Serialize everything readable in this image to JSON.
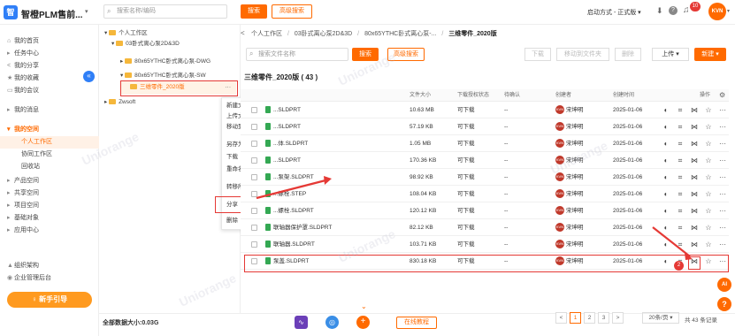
{
  "topbar": {
    "logo_text": "智",
    "app_title": "智橙PLM售前...",
    "search_placeholder": "搜索名称/编码",
    "search_label": "搜索",
    "advanced_search_label": "高级搜索",
    "start_mode": "启动方式 - 正式版 ▾",
    "notification_count": "10",
    "user_initials": "KVN"
  },
  "sidebar": {
    "items": [
      {
        "label": "我的首页",
        "icon": "⌂"
      },
      {
        "label": "任务中心",
        "icon": "▸"
      },
      {
        "label": "我的分享",
        "icon": "<"
      },
      {
        "label": "我的收藏",
        "icon": "★"
      },
      {
        "label": "我的会议",
        "icon": "▭"
      },
      {
        "label": "我的消息",
        "icon": "▸"
      },
      {
        "label": "我的空间",
        "icon": "▾"
      },
      {
        "label": "个人工作区",
        "icon": ""
      },
      {
        "label": "协同工作区",
        "icon": ""
      },
      {
        "label": "回收站",
        "icon": ""
      },
      {
        "label": "产品空间",
        "icon": "▸"
      },
      {
        "label": "共享空间",
        "icon": "▸"
      },
      {
        "label": "项目空间",
        "icon": "▸"
      },
      {
        "label": "基础对象",
        "icon": "▸"
      },
      {
        "label": "应用中心",
        "icon": "▸"
      },
      {
        "label": "组织架构",
        "icon": "▲"
      },
      {
        "label": "企业管理后台",
        "icon": "◉"
      }
    ],
    "guide_button": "新手引导",
    "collapse_glyph": "«"
  },
  "tree": {
    "nodes": [
      {
        "label": "个人工作区",
        "toggle": "▾"
      },
      {
        "label": "03卧式离心泵2D&3D",
        "toggle": "▾"
      },
      {
        "label": "80x65YTHC卧式离心泵-DWG",
        "toggle": "▸"
      },
      {
        "label": "80x65YTHC卧式离心泵-SW",
        "toggle": "▾"
      },
      {
        "label": "三维零件_2020版",
        "toggle": ""
      },
      {
        "label": "Zwsoft",
        "toggle": "▸"
      }
    ],
    "more_glyph": "···",
    "total_data": "全部数据大小:0.03G"
  },
  "context_menu": {
    "items": [
      "新建文件夹",
      "上传文件",
      "移动到文件夹",
      "另存为",
      "下载",
      "重命名",
      "转移所有权",
      "分享",
      "删除"
    ],
    "step_one": "1"
  },
  "main": {
    "breadcrumb_back": "<",
    "breadcrumb": [
      "个人工作区",
      "03卧式离心泵2D&3D",
      "80x65YTHC卧式离心泵-...",
      "三维零件_2020版"
    ],
    "breadcrumb_sep": "/",
    "search_placeholder": "搜索文件名称",
    "search_label": "搜索",
    "advanced_label": "高级搜索",
    "toolbar": {
      "download": "下载",
      "move": "移动到文件夹",
      "delete": "删除",
      "upload": "上传 ▾",
      "new": "新建 ▾"
    },
    "folder_title": "三维零件_2020版 ( 43 )",
    "columns": {
      "size": "文件大小",
      "download_auth": "下载授权状态",
      "auth": "待确认",
      "creator": "创建者",
      "created": "创建时间",
      "ops": "操作"
    },
    "rows": [
      {
        "name": "...SLDPRT",
        "size": "10.63 MB",
        "dl": "可下载",
        "auth": "--",
        "creator": "宋坤明",
        "date": "2025-01-06"
      },
      {
        "name": "...SLDPRT",
        "size": "57.19 KB",
        "dl": "可下载",
        "auth": "--",
        "creator": "宋坤明",
        "date": "2025-01-06"
      },
      {
        "name": "...体.SLDPRT",
        "size": "1.05 MB",
        "dl": "可下载",
        "auth": "--",
        "creator": "宋坤明",
        "date": "2025-01-06"
      },
      {
        "name": "...SLDPRT",
        "size": "170.36 KB",
        "dl": "可下载",
        "auth": "--",
        "creator": "宋坤明",
        "date": "2025-01-06"
      },
      {
        "name": "...泵架.SLDPRT",
        "size": "98.92 KB",
        "dl": "可下载",
        "auth": "--",
        "creator": "宋坤明",
        "date": "2025-01-06"
      },
      {
        "name": "...螺栓.STEP",
        "size": "108.04 KB",
        "dl": "可下载",
        "auth": "--",
        "creator": "宋坤明",
        "date": "2025-01-06"
      },
      {
        "name": "...螺栓.SLDPRT",
        "size": "120.12 KB",
        "dl": "可下载",
        "auth": "--",
        "creator": "宋坤明",
        "date": "2025-01-06"
      },
      {
        "name": "联轴器保护罩.SLDPRT",
        "size": "82.12 KB",
        "dl": "可下载",
        "auth": "--",
        "creator": "宋坤明",
        "date": "2025-01-06"
      },
      {
        "name": "联轴器.SLDPRT",
        "size": "103.71 KB",
        "dl": "可下载",
        "auth": "--",
        "creator": "宋坤明",
        "date": "2025-01-06"
      },
      {
        "name": "泵盖.SLDPRT",
        "size": "830.18 KB",
        "dl": "可下载",
        "auth": "--",
        "creator": "宋坤明",
        "date": "2025-01-06"
      }
    ],
    "row_action_icons": [
      "view-icon",
      "scan-icon",
      "share-icon",
      "favorite-icon",
      "more-icon"
    ],
    "step_two": "2",
    "watermark": "Uniorange"
  },
  "footer": {
    "chevron": "⌄",
    "online_tutorial": "在线教程",
    "pages": [
      "1",
      "2",
      "3"
    ],
    "prev": "<",
    "next": ">",
    "page_size": "20条/页 ▾",
    "total_records": "共 43 条记录",
    "float_ai": "AI",
    "float_help": "?"
  },
  "colors": {
    "accent": "#ff6a00",
    "alert": "#e53935",
    "brand": "#2f7ff7"
  }
}
